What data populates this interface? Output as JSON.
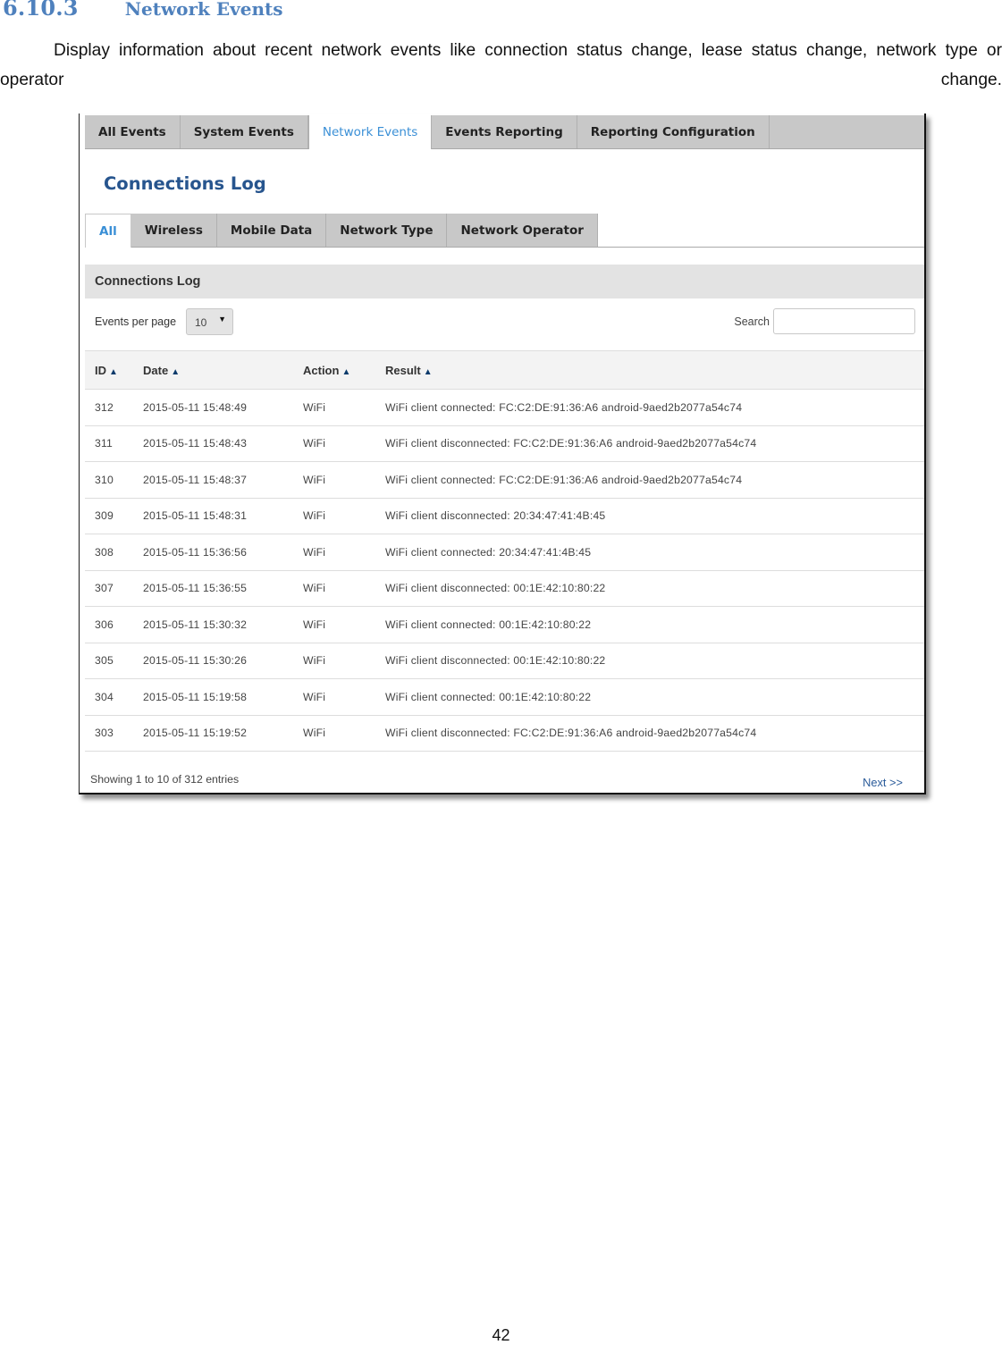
{
  "document": {
    "section_number": "6.10.3",
    "section_title": "Network Events",
    "paragraph": "Display information about recent network events like connection status change, lease status change, network type or operator change.",
    "page_number": "42"
  },
  "screenshot": {
    "top_tabs": [
      {
        "label": "All Events",
        "active": false
      },
      {
        "label": "System Events",
        "active": false
      },
      {
        "label": "Network Events",
        "active": true
      },
      {
        "label": "Events Reporting",
        "active": false
      },
      {
        "label": "Reporting Configuration",
        "active": false
      }
    ],
    "page_title": "Connections Log",
    "sub_tabs": [
      {
        "label": "All",
        "active": true
      },
      {
        "label": "Wireless",
        "active": false
      },
      {
        "label": "Mobile Data",
        "active": false
      },
      {
        "label": "Network Type",
        "active": false
      },
      {
        "label": "Network Operator",
        "active": false
      }
    ],
    "section_header": "Connections Log",
    "events_per_page": {
      "label": "Events per page",
      "value": "10",
      "icon": "dropdown-arrow-icon"
    },
    "search": {
      "label": "Search",
      "value": "",
      "placeholder": ""
    },
    "table": {
      "sort_icon": "sort-up-icon",
      "columns": [
        "ID",
        "Date",
        "Action",
        "Result"
      ],
      "rows": [
        [
          "312",
          "2015-05-11 15:48:49",
          "WiFi",
          "WiFi client connected: FC:C2:DE:91:36:A6 android-9aed2b2077a54c74"
        ],
        [
          "311",
          "2015-05-11 15:48:43",
          "WiFi",
          "WiFi client disconnected: FC:C2:DE:91:36:A6 android-9aed2b2077a54c74"
        ],
        [
          "310",
          "2015-05-11 15:48:37",
          "WiFi",
          "WiFi client connected: FC:C2:DE:91:36:A6 android-9aed2b2077a54c74"
        ],
        [
          "309",
          "2015-05-11 15:48:31",
          "WiFi",
          "WiFi client disconnected: 20:34:47:41:4B:45"
        ],
        [
          "308",
          "2015-05-11 15:36:56",
          "WiFi",
          "WiFi client connected: 20:34:47:41:4B:45"
        ],
        [
          "307",
          "2015-05-11 15:36:55",
          "WiFi",
          "WiFi client disconnected: 00:1E:42:10:80:22"
        ],
        [
          "306",
          "2015-05-11 15:30:32",
          "WiFi",
          "WiFi client connected: 00:1E:42:10:80:22"
        ],
        [
          "305",
          "2015-05-11 15:30:26",
          "WiFi",
          "WiFi client disconnected: 00:1E:42:10:80:22"
        ],
        [
          "304",
          "2015-05-11 15:19:58",
          "WiFi",
          "WiFi client connected: 00:1E:42:10:80:22"
        ],
        [
          "303",
          "2015-05-11 15:19:52",
          "WiFi",
          "WiFi client disconnected: FC:C2:DE:91:36:A6 android-9aed2b2077a54c74"
        ]
      ]
    },
    "footer_info": "Showing 1 to 10 of 312 entries",
    "next_label": "Next >>"
  },
  "colors": {
    "heading_blue": "#4f81bd",
    "active_tab_blue": "#3a8fd6",
    "title_blue": "#27558e",
    "tab_gray": "#c8c8c8",
    "link_blue": "#2a5b9a"
  }
}
